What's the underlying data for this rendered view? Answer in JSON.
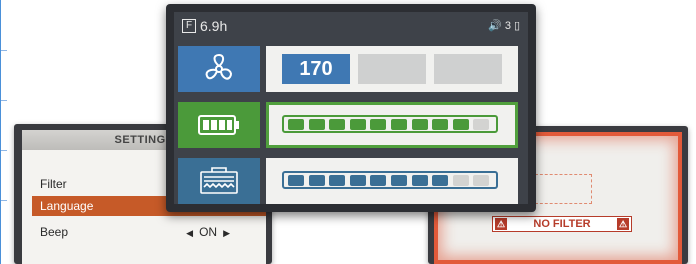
{
  "settings_screen": {
    "title": "SETTINGS",
    "rows": [
      {
        "label": "Filter",
        "value": ""
      },
      {
        "label": "Language",
        "value": ""
      },
      {
        "label": "Beep",
        "value": "ON"
      }
    ],
    "active_color": "#c65a28"
  },
  "main_screen": {
    "status": {
      "filter_badge": "F",
      "runtime": "6.9h",
      "speaker_icon": "speaker-icon",
      "signal_text": "3"
    },
    "fan": {
      "icon": "fan-icon",
      "speed_value": "170",
      "speed_levels": 3,
      "active_level": 1,
      "color": "#3f78b3"
    },
    "battery": {
      "icon": "battery-icon",
      "segments_total": 10,
      "segments_filled": 9,
      "color": "#4b9a3a",
      "selected": true
    },
    "filter": {
      "icon": "filter-icon",
      "segments_total": 10,
      "segments_filled": 8,
      "color": "#3a6f95"
    }
  },
  "alert_screen": {
    "message": "NO FILTER",
    "warning_icon": "warning-icon",
    "alert_color": "#e25a3a"
  }
}
